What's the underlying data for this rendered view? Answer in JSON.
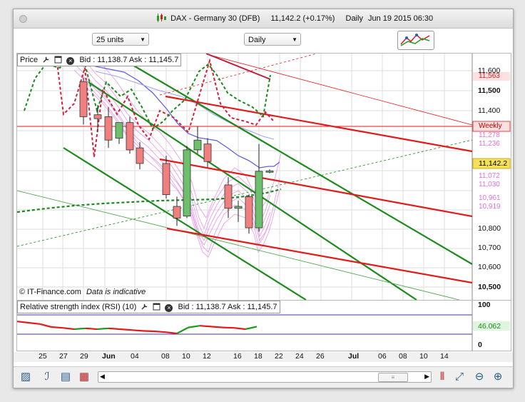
{
  "window": {
    "title_instrument": "DAX - Germany 30 (DFB)",
    "title_price": "11,142.2 (+0.17%)",
    "title_period": "Daily",
    "title_datetime": "Jun 19 2015 06:30"
  },
  "toolbar": {
    "units_select": "25 units",
    "period_select": "Daily"
  },
  "price_panel": {
    "label": "Price",
    "bid_ask": "Bid : 11,138.7 Ask : 11,145.7",
    "copyright": "© IT-Finance.com",
    "indicative": "Data is indicative",
    "y_axis_labels": [
      "11,600",
      "11,500",
      "11,400",
      "11,300",
      "10,800",
      "10,700",
      "10,600",
      "10,500"
    ],
    "price_tags": {
      "red_level": "11,563",
      "weekly_label": "Weekly",
      "current_price": "11,142.2",
      "band_labels": [
        "11,278",
        "11,236",
        "11,072",
        "11,030",
        "10,961",
        "10,919"
      ]
    },
    "colors": {
      "support_red": "#e31a1a",
      "channel_green": "#1c8a1c",
      "bull_candle": "#6cc06c",
      "bear_candle": "#f08080",
      "band_pink": "#e88ee8",
      "ma_blue": "#6060e0",
      "current_bg": "#f5e05a"
    }
  },
  "rsi_panel": {
    "label": "Relative strength index (RSI) (10)",
    "bid_ask": "Bid : 11,138.7 Ask : 11,145.7",
    "y_axis_labels": [
      "100",
      "0"
    ],
    "current_value": "46.062"
  },
  "date_axis": [
    "25",
    "27",
    "29",
    "Jun",
    "04",
    "08",
    "10",
    "12",
    "16",
    "18",
    "22",
    "24",
    "26",
    "Jul",
    "06",
    "08",
    "10",
    "14"
  ],
  "chart_data": {
    "type": "candlestick",
    "title": "DAX - Germany 30 (DFB)",
    "period": "Daily",
    "ylim": [
      10450,
      11700
    ],
    "candles": [
      {
        "date": "May 29",
        "open": 11600,
        "high": 11620,
        "close": 11420,
        "low": 11380
      },
      {
        "date": "Jun 01",
        "open": 11430,
        "high": 11480,
        "close": 11410,
        "low": 11340
      },
      {
        "date": "Jun 02",
        "open": 11420,
        "high": 11470,
        "close": 11300,
        "low": 11260
      },
      {
        "date": "Jun 03",
        "open": 11310,
        "high": 11380,
        "close": 11390,
        "low": 11280
      },
      {
        "date": "Jun 04",
        "open": 11390,
        "high": 11420,
        "close": 11250,
        "low": 11230
      },
      {
        "date": "Jun 05",
        "open": 11260,
        "high": 11290,
        "close": 11180,
        "low": 11150
      },
      {
        "date": "Jun 08",
        "open": 11180,
        "high": 11220,
        "close": 11020,
        "low": 11000
      },
      {
        "date": "Jun 09",
        "open": 10960,
        "high": 11010,
        "close": 10900,
        "low": 10860
      },
      {
        "date": "Jun 10",
        "open": 10910,
        "high": 11270,
        "close": 11250,
        "low": 10900
      },
      {
        "date": "Jun 11",
        "open": 11250,
        "high": 11370,
        "close": 11300,
        "low": 11230
      },
      {
        "date": "Jun 12",
        "open": 11280,
        "high": 11310,
        "close": 11190,
        "low": 11160
      },
      {
        "date": "Jun 15",
        "open": 11070,
        "high": 11110,
        "close": 10950,
        "low": 10900
      },
      {
        "date": "Jun 16",
        "open": 10950,
        "high": 10990,
        "close": 10960,
        "low": 10880
      },
      {
        "date": "Jun 17",
        "open": 11010,
        "high": 11020,
        "close": 10850,
        "low": 10820
      },
      {
        "date": "Jun 18",
        "open": 10850,
        "high": 11280,
        "close": 11140,
        "low": 10830
      },
      {
        "date": "Jun 19",
        "open": 11135,
        "high": 11150,
        "close": 11142,
        "low": 11130
      }
    ],
    "rsi": {
      "ylim": [
        0,
        100
      ],
      "values": [
        58,
        55,
        52,
        45,
        43,
        40,
        42,
        40,
        42,
        40,
        38,
        36,
        35,
        33,
        30,
        44,
        48,
        46,
        44,
        43,
        40,
        46
      ]
    }
  }
}
